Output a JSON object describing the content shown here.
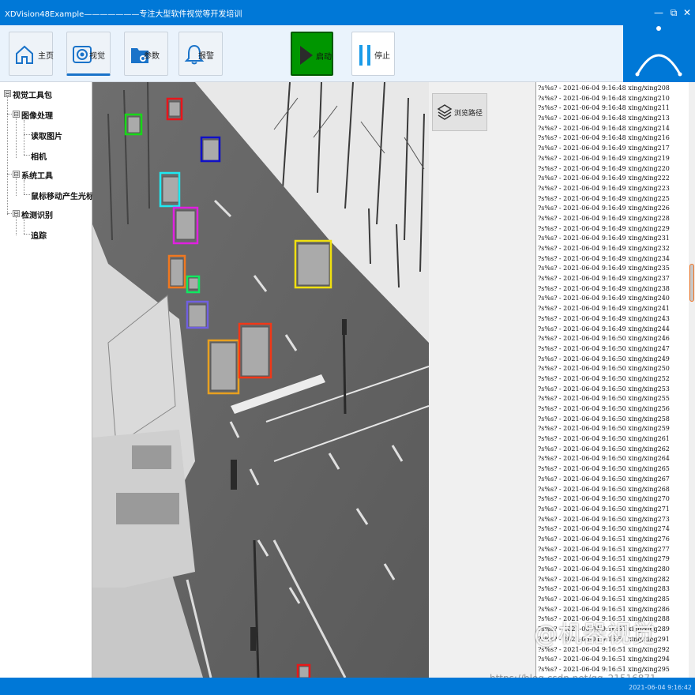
{
  "window": {
    "title": "XDVision48Example———————专注大型软件视觉等开发培训",
    "minimize": "—",
    "restore": "⧉",
    "close": "✕"
  },
  "toolbar": {
    "buttons": [
      {
        "label": "主页",
        "icon": "home-icon"
      },
      {
        "label": "视觉",
        "icon": "eye-icon"
      },
      {
        "label": "参数",
        "icon": "settings-folder-icon"
      },
      {
        "label": "报警",
        "icon": "bell-icon"
      },
      {
        "label": "启动",
        "icon": "play-icon"
      },
      {
        "label": "停止",
        "icon": "pause-icon"
      }
    ],
    "active": "视觉",
    "accent": "#0078d7"
  },
  "tree": {
    "items": [
      {
        "label": "视觉工具包",
        "expander": "⊟"
      },
      {
        "label": "图像处理",
        "expander": "⊟"
      },
      {
        "label": "读取图片"
      },
      {
        "label": "相机"
      },
      {
        "label": "系统工具",
        "expander": "⊟"
      },
      {
        "label": "鼠标移动产生光标"
      },
      {
        "label": "检测识别",
        "expander": "⊟"
      },
      {
        "label": "追踪"
      }
    ]
  },
  "middle": {
    "browse_label": "浏览路径"
  },
  "log": {
    "lines": [
      "?s%s? - 2021-06-04  9:16:48   xing/xing208",
      "?s%s? - 2021-06-04  9:16:48   xing/xing210",
      "?s%s? - 2021-06-04  9:16:48   xing/xing211",
      "?s%s? - 2021-06-04  9:16:48   xing/xing213",
      "?s%s? - 2021-06-04  9:16:48   xing/xing214",
      "?s%s? - 2021-06-04  9:16:48   xing/xing216",
      "?s%s? - 2021-06-04  9:16:49   xing/xing217",
      "?s%s? - 2021-06-04  9:16:49   xing/xing219",
      "?s%s? - 2021-06-04  9:16:49   xing/xing220",
      "?s%s? - 2021-06-04  9:16:49   xing/xing222",
      "?s%s? - 2021-06-04  9:16:49   xing/xing223",
      "?s%s? - 2021-06-04  9:16:49   xing/xing225",
      "?s%s? - 2021-06-04  9:16:49   xing/xing226",
      "?s%s? - 2021-06-04  9:16:49   xing/xing228",
      "?s%s? - 2021-06-04  9:16:49   xing/xing229",
      "?s%s? - 2021-06-04  9:16:49   xing/xing231",
      "?s%s? - 2021-06-04  9:16:49   xing/xing232",
      "?s%s? - 2021-06-04  9:16:49   xing/xing234",
      "?s%s? - 2021-06-04  9:16:49   xing/xing235",
      "?s%s? - 2021-06-04  9:16:49   xing/xing237",
      "?s%s? - 2021-06-04  9:16:49   xing/xing238",
      "?s%s? - 2021-06-04  9:16:49   xing/xing240",
      "?s%s? - 2021-06-04  9:16:49   xing/xing241",
      "?s%s? - 2021-06-04  9:16:49   xing/xing243",
      "?s%s? - 2021-06-04  9:16:49   xing/xing244",
      "?s%s? - 2021-06-04  9:16:50   xing/xing246",
      "?s%s? - 2021-06-04  9:16:50   xing/xing247",
      "?s%s? - 2021-06-04  9:16:50   xing/xing249",
      "?s%s? - 2021-06-04  9:16:50   xing/xing250",
      "?s%s? - 2021-06-04  9:16:50   xing/xing252",
      "?s%s? - 2021-06-04  9:16:50   xing/xing253",
      "?s%s? - 2021-06-04  9:16:50   xing/xing255",
      "?s%s? - 2021-06-04  9:16:50   xing/xing256",
      "?s%s? - 2021-06-04  9:16:50   xing/xing258",
      "?s%s? - 2021-06-04  9:16:50   xing/xing259",
      "?s%s? - 2021-06-04  9:16:50   xing/xing261",
      "?s%s? - 2021-06-04  9:16:50   xing/xing262",
      "?s%s? - 2021-06-04  9:16:50   xing/xing264",
      "?s%s? - 2021-06-04  9:16:50   xing/xing265",
      "?s%s? - 2021-06-04  9:16:50   xing/xing267",
      "?s%s? - 2021-06-04  9:16:50   xing/xing268",
      "?s%s? - 2021-06-04  9:16:50   xing/xing270",
      "?s%s? - 2021-06-04  9:16:50   xing/xing271",
      "?s%s? - 2021-06-04  9:16:50   xing/xing273",
      "?s%s? - 2021-06-04  9:16:50   xing/xing274",
      "?s%s? - 2021-06-04  9:16:51   xing/xing276",
      "?s%s? - 2021-06-04  9:16:51   xing/xing277",
      "?s%s? - 2021-06-04  9:16:51   xing/xing279",
      "?s%s? - 2021-06-04  9:16:51   xing/xing280",
      "?s%s? - 2021-06-04  9:16:51   xing/xing282",
      "?s%s? - 2021-06-04  9:16:51   xing/xing283",
      "?s%s? - 2021-06-04  9:16:51   xing/xing285",
      "?s%s? - 2021-06-04  9:16:51   xing/xing286",
      "?s%s? - 2021-06-04  9:16:51   xing/xing288",
      "?s%s? - 2021-06-04  9:16:51   xing/xing289",
      "?s%s? - 2021-06-04  9:16:51   xing/xing291",
      "?s%s? - 2021-06-04  9:16:51   xing/xing292",
      "?s%s? - 2021-06-04  9:16:51   xing/xing294",
      "?s%s? - 2021-06-04  9:16:51   xing/xing295"
    ]
  },
  "detections": {
    "colors": [
      "#e8151b",
      "#18d818",
      "#1010c8",
      "#20e8f0",
      "#e020e0",
      "#f07820",
      "#10e860",
      "#7060e0",
      "#e8a020",
      "#f03818",
      "#f0e010",
      "#e81818"
    ]
  },
  "watermark": "@机器视觉",
  "url_watermark": "https://blog.csdn.net/qq_21516871",
  "status": {
    "time": "2021-06-04 9:16:42"
  }
}
